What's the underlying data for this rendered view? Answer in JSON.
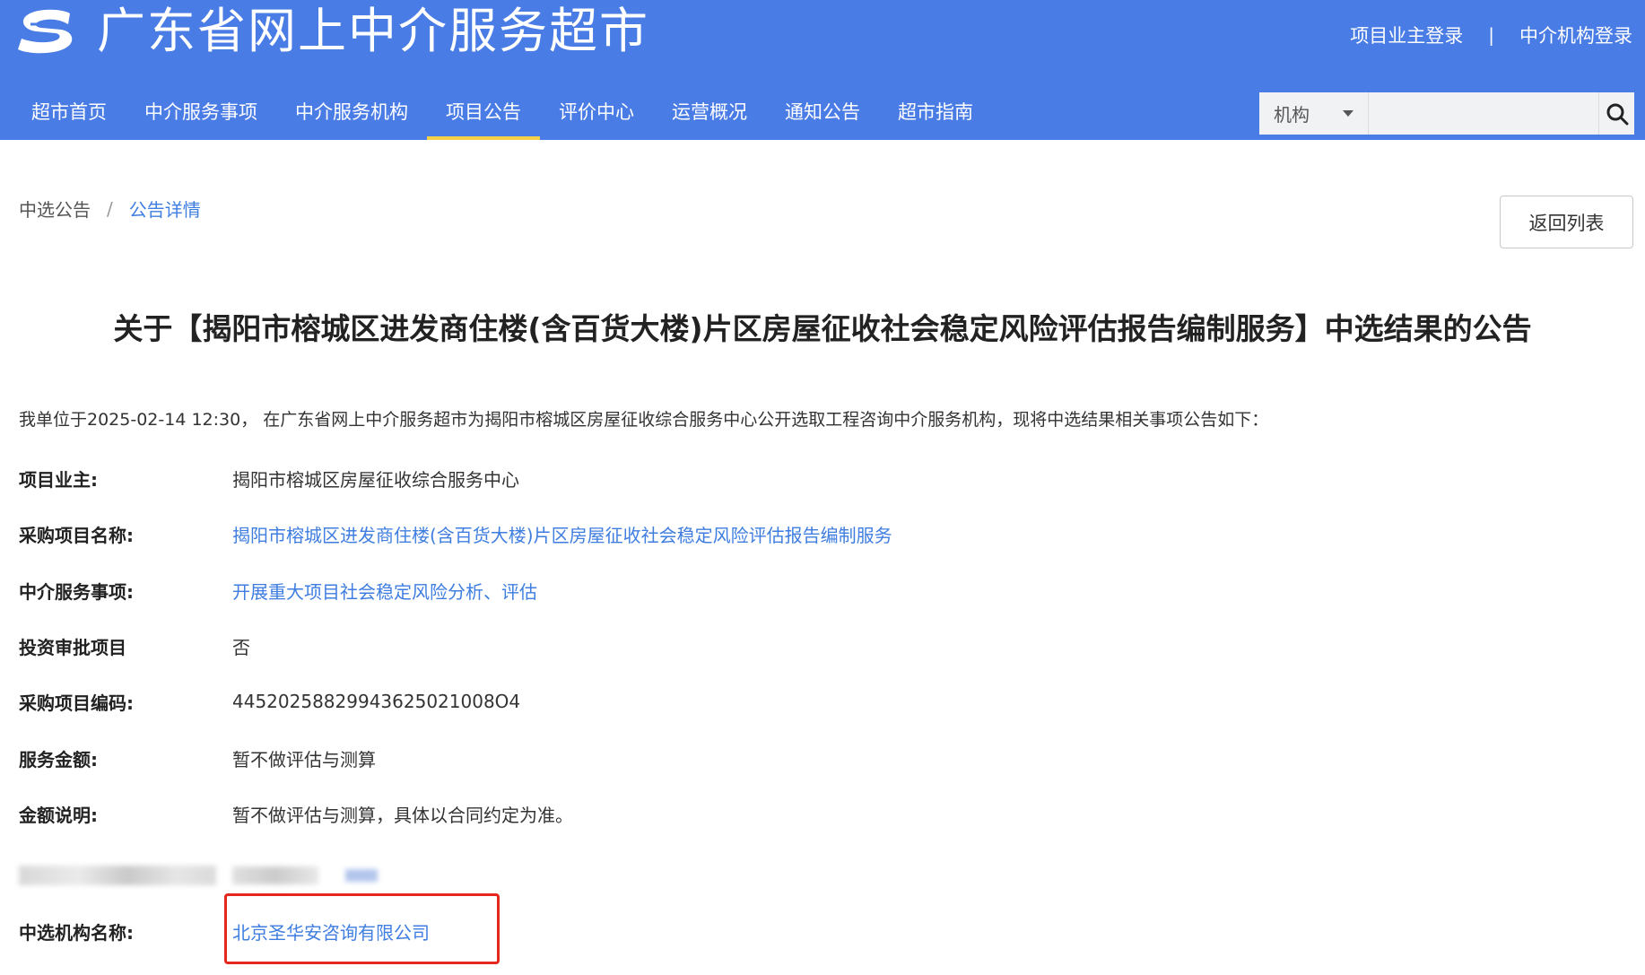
{
  "header": {
    "site_title": "广东省网上中介服务超市",
    "login_owner": "项目业主登录",
    "separator": "|",
    "login_agency": "中介机构登录"
  },
  "nav": {
    "items": [
      {
        "label": "超市首页"
      },
      {
        "label": "中介服务事项"
      },
      {
        "label": "中介服务机构"
      },
      {
        "label": "项目公告",
        "active": true
      },
      {
        "label": "评价中心"
      },
      {
        "label": "运营概况"
      },
      {
        "label": "通知公告"
      },
      {
        "label": "超市指南"
      }
    ]
  },
  "search": {
    "category": "机构",
    "placeholder": "",
    "icon": "search-icon"
  },
  "breadcrumb": {
    "parent": "中选公告",
    "separator": "/",
    "current": "公告详情"
  },
  "back_button": "返回列表",
  "notice": {
    "title": "关于【揭阳市榕城区进发商住楼(含百货大楼)片区房屋征收社会稳定风险评估报告编制服务】中选结果的公告",
    "intro": "我单位于2025-02-14 12:30， 在广东省网上中介服务超市为揭阳市榕城区房屋征收综合服务中心公开选取工程咨询中介服务机构，现将中选结果相关事项公告如下：",
    "fields": [
      {
        "label": "项目业主:",
        "value": "揭阳市榕城区房屋征收综合服务中心",
        "link": false
      },
      {
        "label": "采购项目名称:",
        "value": "揭阳市榕城区进发商住楼(含百货大楼)片区房屋征收社会稳定风险评估报告编制服务",
        "link": true
      },
      {
        "label": "中介服务事项:",
        "value": "开展重大项目社会稳定风险分析、评估",
        "link": true
      },
      {
        "label": "投资审批项目",
        "value": "否",
        "link": false
      },
      {
        "label": "采购项目编码:",
        "value": "44520258829943625021008O4",
        "link": false
      },
      {
        "label": "服务金额:",
        "value": "暂不做评估与测算",
        "link": false
      },
      {
        "label": "金额说明:",
        "value": "暂不做评估与测算，具体以合同约定为准。",
        "link": false
      },
      {
        "label": "中选机构名称:",
        "value": "北京圣华安咨询有限公司",
        "link": true
      }
    ]
  },
  "colors": {
    "header_bg": "#4a7ce6",
    "link": "#3f7ee0",
    "active_underline": "#f5d14a",
    "highlight_box": "#e5281e"
  }
}
